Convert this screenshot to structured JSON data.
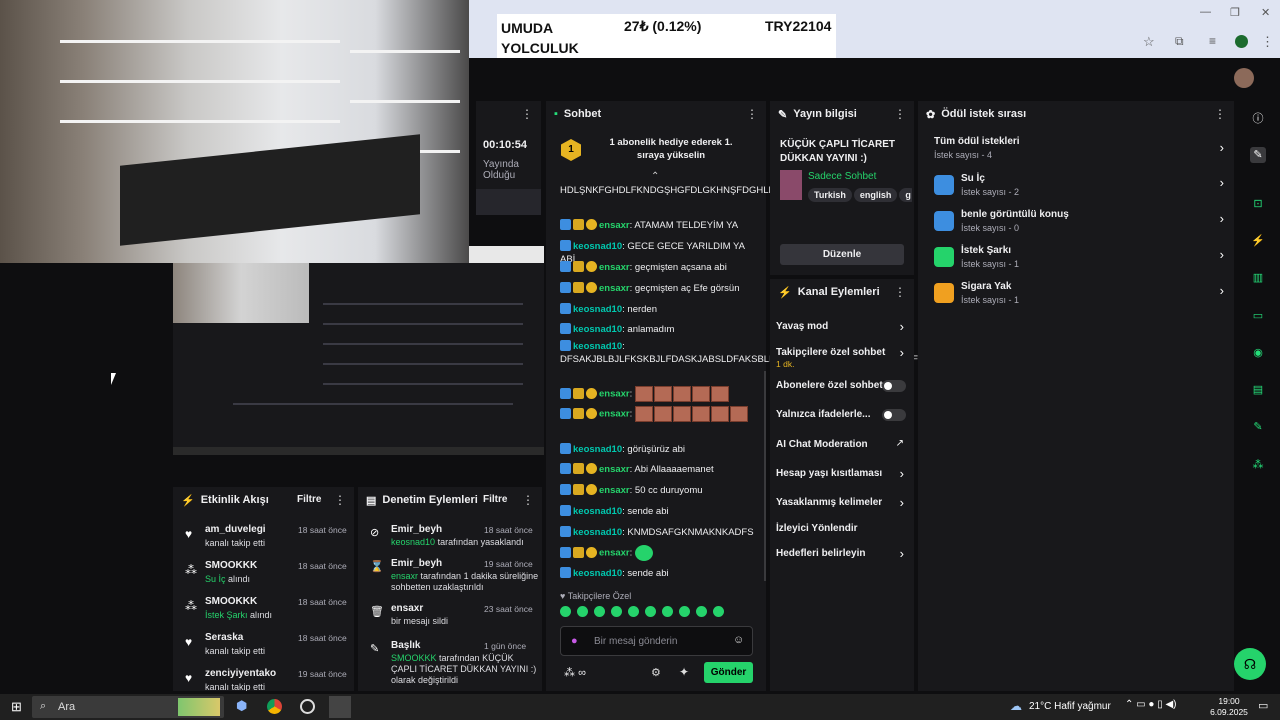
{
  "browser": {
    "ticker_name": "UMUDA YOLCULUK",
    "ticker_change": "27₺ (0.12%)",
    "ticker_symbol": "TRY22104",
    "min": "—",
    "max": "❐",
    "close": "✕"
  },
  "left_strip": {
    "uptime": "00:10:54",
    "status": "Yayında Olduğu"
  },
  "chat": {
    "title": "Sohbet",
    "pinned": "1 abonelik hediye ederek 1. sıraya yükselin",
    "pinned_rank": "1",
    "messages": [
      {
        "user": "",
        "text": "HDLŞNKFGHDLFKNDGŞHGFDLGKHNŞFDGHLNKŞ"
      },
      {
        "user": "ensaxr",
        "text": "ATAMAM TELDEYİM YA"
      },
      {
        "user": "keosnad10",
        "text": "GECE GECE YARILDIM YA ABİ"
      },
      {
        "user": "ensaxr",
        "text": "geçmişten açsana abi"
      },
      {
        "user": "ensaxr",
        "text": "geçmişten aç Efe görsün"
      },
      {
        "user": "keosnad10",
        "text": "nerden"
      },
      {
        "user": "keosnad10",
        "text": "anlamadım"
      },
      {
        "user": "keosnad10",
        "text": "DFSAKJBLBJLFKSKBJLFDASKJABSLDFAKSBLDJFASFDKBJLSKAFDBJLKBJASFDLBAJKFSD"
      },
      {
        "user": "ensaxr",
        "text": ""
      },
      {
        "user": "ensaxr",
        "text": ""
      },
      {
        "user": "keosnad10",
        "text": "görüşürüz abi"
      },
      {
        "user": "ensaxr",
        "text": "Abi Allaaaaemanet"
      },
      {
        "user": "ensaxr",
        "text": "50 cc duruyomu"
      },
      {
        "user": "keosnad10",
        "text": "sende abi"
      },
      {
        "user": "keosnad10",
        "text": "KNMDSAFGKNMAKNKADFS"
      },
      {
        "user": "ensaxr",
        "text": ""
      },
      {
        "user": "keosnad10",
        "text": "sende abi"
      }
    ],
    "followers_only": "Takipçilere Özel",
    "input_placeholder": "Bir mesaj gönderin",
    "points": "∞",
    "send": "Gönder"
  },
  "stream_info": {
    "title": "Yayın bilgisi",
    "stream_title": "KÜÇÜK ÇAPLI TİCARET DÜKKAN YAYINI :)",
    "category": "Sadece Sohbet",
    "tags": [
      "Turkish",
      "english",
      "g"
    ],
    "edit": "Düzenle"
  },
  "channel_actions": {
    "title": "Kanal Eylemleri",
    "items": [
      {
        "label": "Yavaş mod",
        "sub": ""
      },
      {
        "label": "Takipçilere özel sohbet",
        "sub": "1 dk."
      },
      {
        "label": "Abonelere özel sohbet",
        "sub": ""
      },
      {
        "label": "Yalnızca ifadelerle...",
        "sub": ""
      },
      {
        "label": "AI Chat Moderation",
        "sub": ""
      },
      {
        "label": "Hesap yaşı kısıtlaması",
        "sub": ""
      },
      {
        "label": "Yasaklanmış kelimeler",
        "sub": ""
      },
      {
        "label": "İzleyici Yönlendir",
        "sub": ""
      },
      {
        "label": "Hedefleri belirleyin",
        "sub": ""
      }
    ]
  },
  "rewards": {
    "title": "Ödül istek sırası",
    "all": "Tüm ödül istekleri",
    "all_count": "İstek sayısı - 4",
    "items": [
      {
        "label": "Su İç",
        "count": "İstek sayısı - 2",
        "color": "#3d8ee0"
      },
      {
        "label": "benle görüntülü konuş",
        "count": "İstek sayısı - 0",
        "color": "#3d8ee0"
      },
      {
        "label": "İstek Şarkı",
        "count": "İstek sayısı - 1",
        "color": "#25d36b"
      },
      {
        "label": "Sigara Yak",
        "count": "İstek sayısı - 1",
        "color": "#f0a020"
      }
    ]
  },
  "activity": {
    "title": "Etkinlik Akışı",
    "filter": "Filtre",
    "items": [
      {
        "user": "am_duvelegi",
        "desc": "kanalı takip etti",
        "hl": "",
        "time": "18 saat önce"
      },
      {
        "user": "SMOOKKK",
        "desc": "alındı",
        "hl": "Su İç",
        "time": "18 saat önce"
      },
      {
        "user": "SMOOKKK",
        "desc": "alındı",
        "hl": "İstek Şarkı",
        "time": "18 saat önce"
      },
      {
        "user": "Seraska",
        "desc": "kanalı takip etti",
        "hl": "",
        "time": "18 saat önce"
      },
      {
        "user": "zenciyiyentako",
        "desc": "kanalı takip etti",
        "hl": "",
        "time": "19 saat önce"
      }
    ]
  },
  "moderation": {
    "title": "Denetim Eylemleri",
    "filter": "Filtre",
    "items": [
      {
        "user": "Emir_beyh",
        "hl": "keosnad10",
        "desc": "tarafından yasaklandı",
        "time": "18 saat önce"
      },
      {
        "user": "Emir_beyh",
        "hl": "ensaxr",
        "desc": "tarafından 1 dakika süreliğine sohbetten uzaklaştırıldı",
        "time": "19 saat önce"
      },
      {
        "user": "ensaxr",
        "hl": "",
        "desc": "bir mesajı sildi",
        "time": "23 saat önce"
      },
      {
        "user": "Başlık",
        "hl": "SMOOKKK",
        "desc": "tarafından KÜÇÜK ÇAPLI TİCARET DÜKKAN YAYINI :) olarak değiştirildi",
        "time": "1 gün önce"
      }
    ]
  },
  "taskbar": {
    "search": "Ara",
    "weather": "21°C  Hafif yağmur",
    "time": "19:00",
    "date": "6.09.2025"
  }
}
